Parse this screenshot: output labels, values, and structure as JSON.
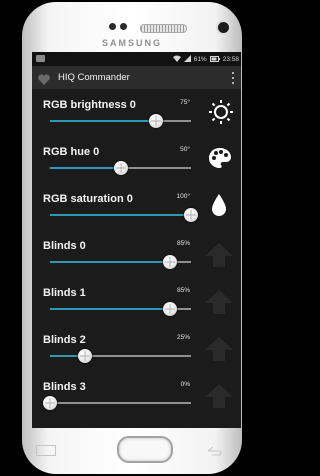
{
  "device": {
    "brand": "SAMSUNG"
  },
  "statusbar": {
    "battery": "61%",
    "time": "23:58"
  },
  "appbar": {
    "title": "HIQ Commander"
  },
  "controls": [
    {
      "label": "RGB brightness 0",
      "value": "75°",
      "level": 0.75,
      "icon": "sun-icon"
    },
    {
      "label": "RGB hue 0",
      "value": "50°",
      "level": 0.5,
      "icon": "palette-icon"
    },
    {
      "label": "RGB saturation 0",
      "value": "100°",
      "level": 1.0,
      "icon": "water-drop-icon"
    },
    {
      "label": "Blinds 0",
      "value": "85%",
      "level": 0.85,
      "icon": "arrow-up-icon"
    },
    {
      "label": "Blinds 1",
      "value": "85%",
      "level": 0.85,
      "icon": "arrow-up-icon"
    },
    {
      "label": "Blinds 2",
      "value": "25%",
      "level": 0.25,
      "icon": "arrow-up-icon"
    },
    {
      "label": "Blinds 3",
      "value": "0%",
      "level": 0.0,
      "icon": "arrow-up-icon"
    }
  ],
  "colors": {
    "accent": "#2f96b8",
    "background": "#1b1b1b",
    "appbar": "#2c2c2c"
  }
}
